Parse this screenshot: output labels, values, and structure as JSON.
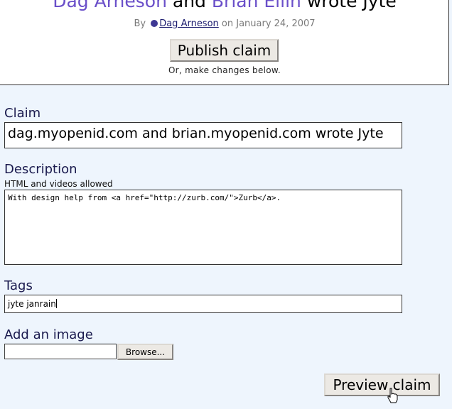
{
  "preview": {
    "title_person1": "Dag Arneson",
    "title_and": "and",
    "title_person2": "Brian Ellin",
    "title_rest": "wrote Jyte",
    "by_label": "By",
    "author": "Dag Arneson",
    "date_text": "on January 24, 2007",
    "publish_label": "Publish claim",
    "changes_note": "Or, make changes below.",
    "person_color": "#6a4fc9"
  },
  "form": {
    "claim_label": "Claim",
    "claim_value": "dag.myopenid.com and brian.myopenid.com wrote Jyte",
    "description_label": "Description",
    "description_hint": "HTML and videos allowed",
    "description_value": "With design help from <a href=\"http://zurb.com/\">Zurb</a>.",
    "tags_label": "Tags",
    "tags_value": "jyte janrain",
    "image_label": "Add an image",
    "browse_label": "Browse...",
    "preview_label": "Preview claim"
  },
  "icons": {
    "author_dot": "user-status-dot-icon",
    "pointer": "hand-cursor-icon"
  }
}
